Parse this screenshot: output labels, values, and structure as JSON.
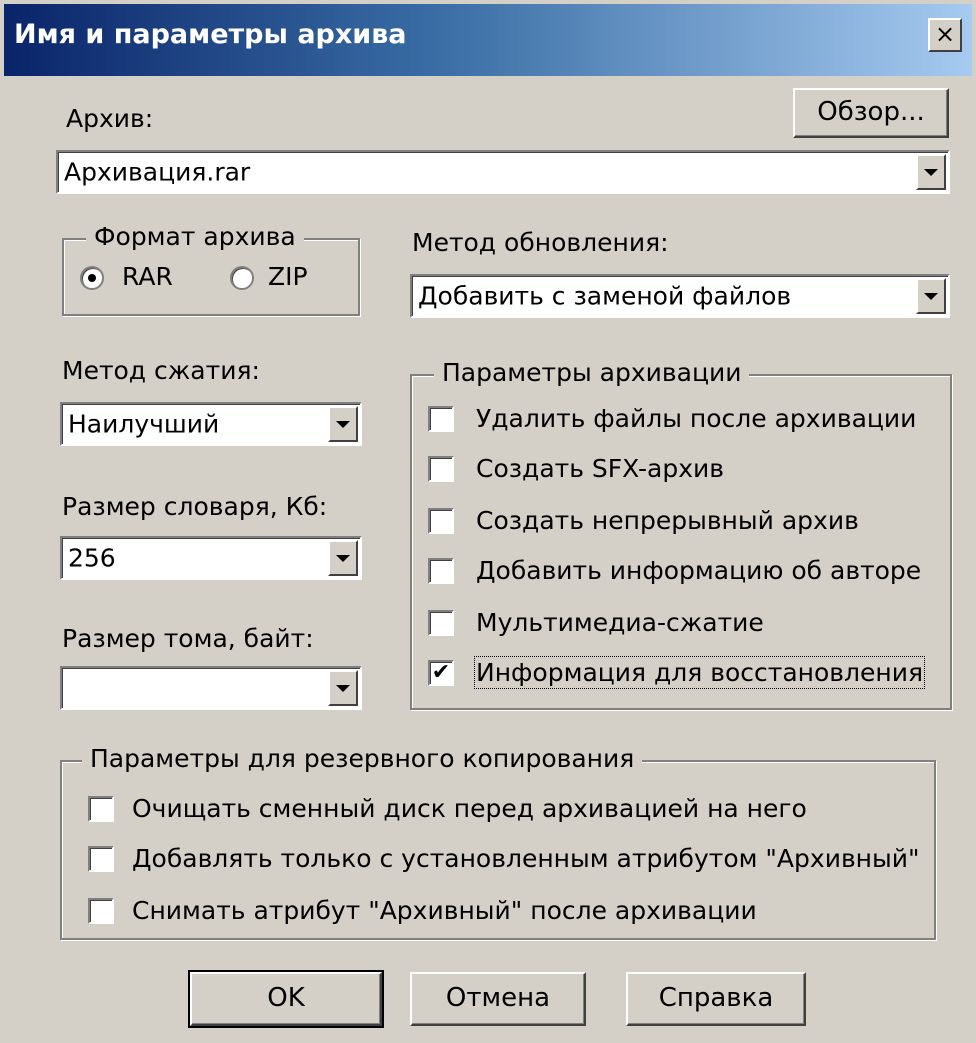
{
  "dialog": {
    "title": "Имя и параметры архива",
    "close_label": "×"
  },
  "archive": {
    "label": "Архив:",
    "value": "Архивация.rar",
    "browse_label": "Обзор..."
  },
  "format": {
    "legend": "Формат архива",
    "options": [
      {
        "label": "RAR",
        "selected": true
      },
      {
        "label": "ZIP",
        "selected": false
      }
    ]
  },
  "update_method": {
    "label": "Метод обновления:",
    "value": "Добавить с заменой файлов"
  },
  "compression": {
    "label": "Метод сжатия:",
    "value": "Наилучший"
  },
  "dictionary": {
    "label": "Размер словаря, Кб:",
    "value": "256"
  },
  "volume": {
    "label": "Размер тома, байт:",
    "value": ""
  },
  "archive_params": {
    "legend": "Параметры архивации",
    "items": [
      {
        "label": "Удалить файлы после архивации",
        "checked": false
      },
      {
        "label": "Создать SFX-архив",
        "checked": false
      },
      {
        "label": "Создать непрерывный архив",
        "checked": false
      },
      {
        "label": "Добавить информацию об авторе",
        "checked": false
      },
      {
        "label": "Мультимедиа-сжатие",
        "checked": false
      },
      {
        "label": "Информация для восстановления",
        "checked": true
      }
    ]
  },
  "backup_params": {
    "legend": "Параметры для резервного копирования",
    "items": [
      {
        "label": "Очищать сменный диск перед архивацией на него",
        "checked": false
      },
      {
        "label": "Добавлять только с установленным атрибутом \"Архивный\"",
        "checked": false
      },
      {
        "label": "Снимать атрибут \"Архивный\" после архивации",
        "checked": false
      }
    ]
  },
  "buttons": {
    "ok": "OK",
    "cancel": "Отмена",
    "help": "Справка"
  },
  "colors": {
    "face": "#d4d0c8",
    "title_start": "#0a246a",
    "title_end": "#a6caf0"
  }
}
